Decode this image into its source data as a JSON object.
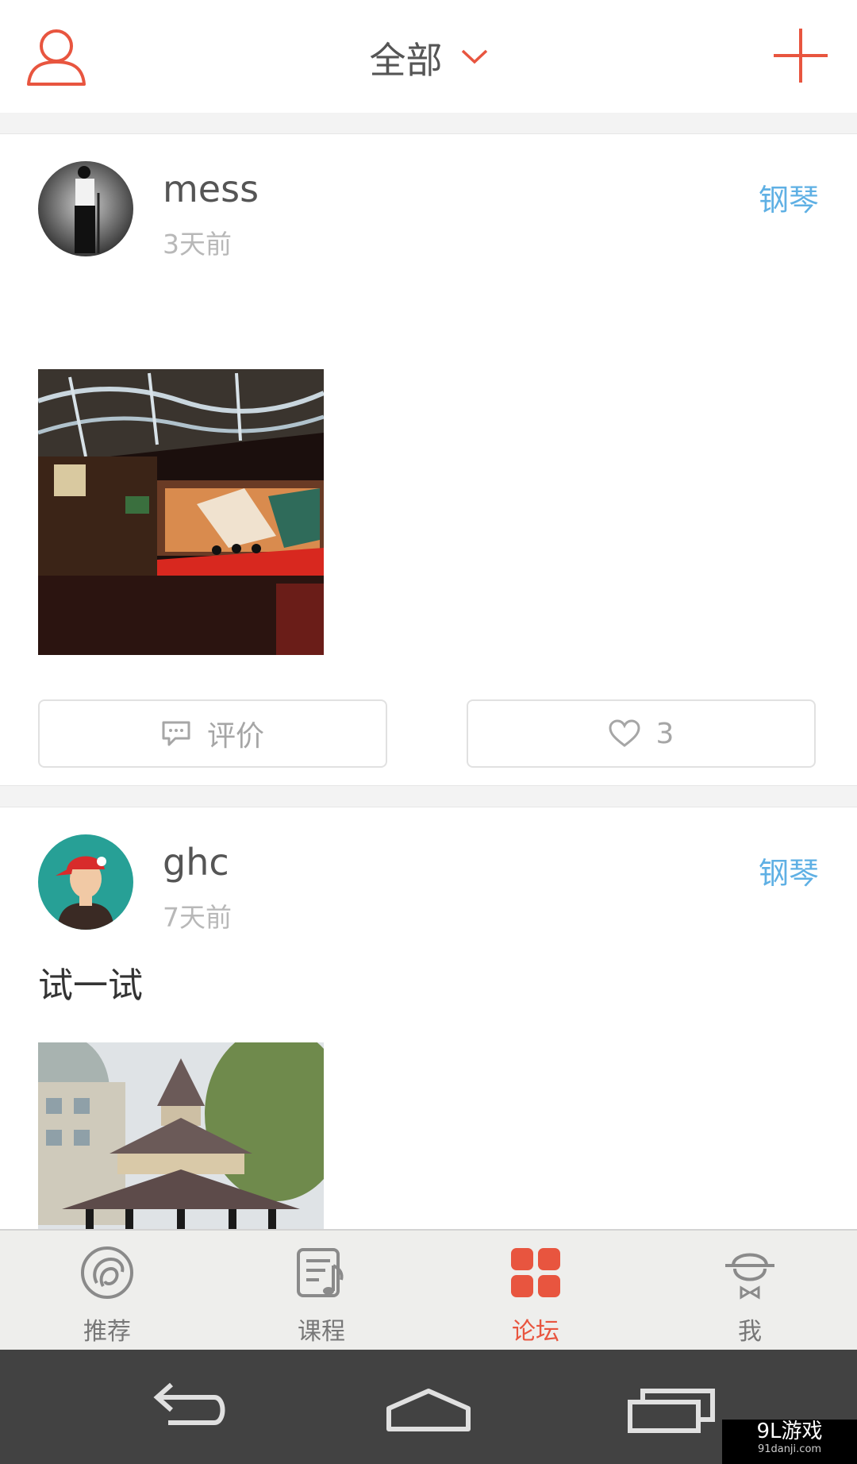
{
  "header": {
    "title": "全部",
    "user_icon": "user-outline-icon",
    "dropdown_icon": "chevron-down-icon",
    "add_icon": "plus-icon",
    "accent_color": "#e8553f"
  },
  "posts": [
    {
      "username": "mess",
      "time": "3天前",
      "category": "钢琴",
      "text": "",
      "photo": "concert-hall-stage-photo",
      "comment_label": "评价",
      "like_count": "3"
    },
    {
      "username": "ghc",
      "time": "7天前",
      "category": "钢琴",
      "text": "试一试",
      "photo": "pavilion-gazebo-photo"
    }
  ],
  "tabs": [
    {
      "label": "推荐",
      "icon": "recommend-swirl-icon",
      "active": false
    },
    {
      "label": "课程",
      "icon": "course-notebook-icon",
      "active": false
    },
    {
      "label": "论坛",
      "icon": "forum-grid-icon",
      "active": true
    },
    {
      "label": "我",
      "icon": "profile-hat-icon",
      "active": false
    }
  ],
  "system_nav": {
    "back_icon": "back-arrow-icon",
    "home_icon": "home-icon",
    "recents_icon": "recent-apps-icon"
  },
  "watermark": {
    "brand": "9L游戏",
    "site": "91danji.com"
  },
  "colors": {
    "category": "#5fb0e4",
    "active_tab": "#e8553f",
    "inactive_tab": "#777777"
  }
}
